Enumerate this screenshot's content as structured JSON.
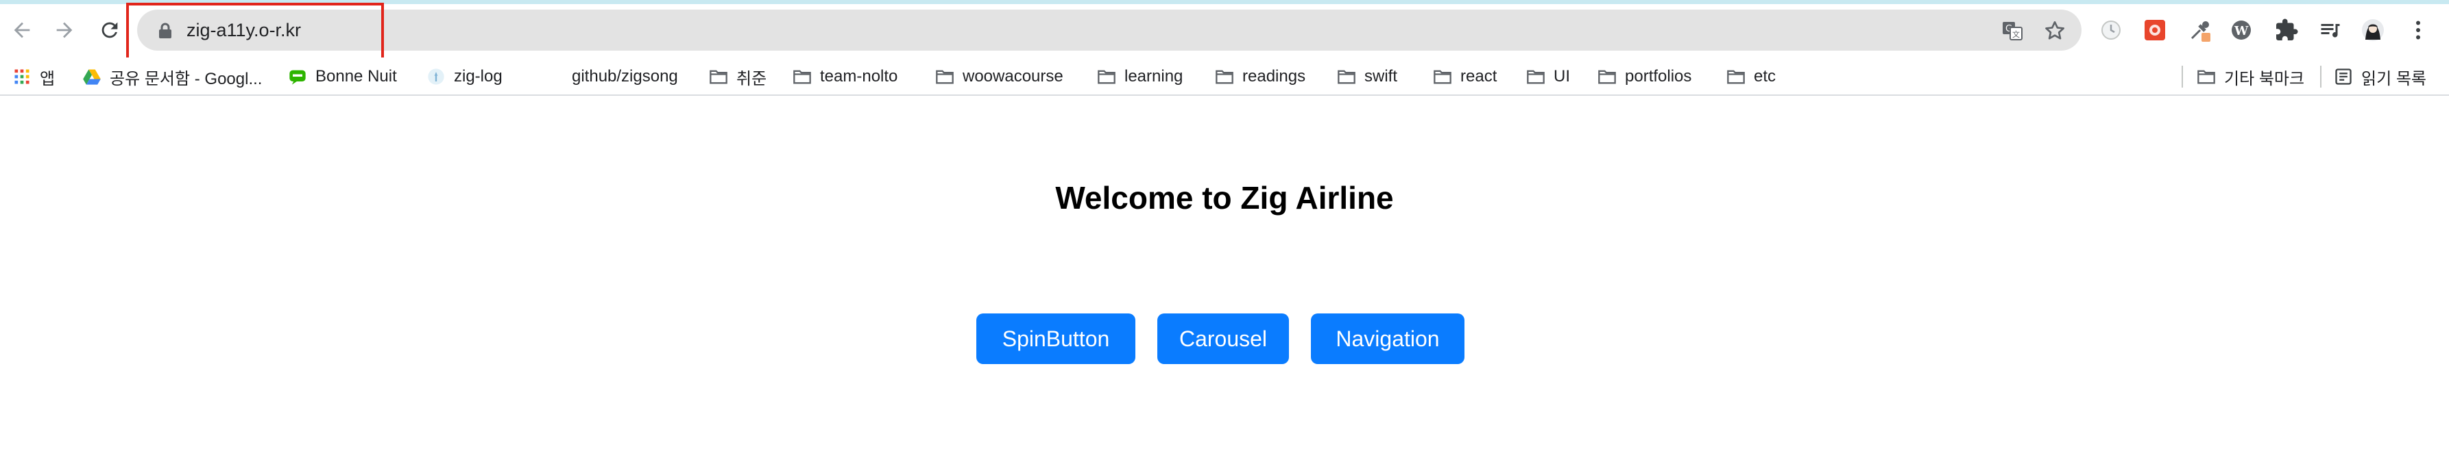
{
  "browser": {
    "url": "zig-a11y.o-r.kr",
    "icons": {
      "back": "arrow-left-icon",
      "forward": "arrow-right-icon",
      "reload": "reload-icon",
      "lock": "lock-icon",
      "translate": "translate-icon",
      "bookmark_star": "star-icon",
      "extensions": "puzzle-icon",
      "reading_list": "reading-list-icon",
      "profile": "avatar-icon",
      "menu": "more-vert-icon"
    }
  },
  "bookmarks": {
    "apps_label": "앱",
    "items": [
      {
        "label": "공유 문서함 - Googl...",
        "icon": "google-drive-icon"
      },
      {
        "label": "Bonne Nuit",
        "icon": "chat-icon"
      },
      {
        "label": "zig-log",
        "icon": "favicon-icon"
      },
      {
        "label": "github/zigsong",
        "icon": ""
      },
      {
        "label": "취준",
        "icon": "folder-icon"
      },
      {
        "label": "team-nolto",
        "icon": "folder-icon"
      },
      {
        "label": "woowacourse",
        "icon": "folder-icon"
      },
      {
        "label": "learning",
        "icon": "folder-icon"
      },
      {
        "label": "readings",
        "icon": "folder-icon"
      },
      {
        "label": "swift",
        "icon": "folder-icon"
      },
      {
        "label": "react",
        "icon": "folder-icon"
      },
      {
        "label": "UI",
        "icon": "folder-icon"
      },
      {
        "label": "portfolios",
        "icon": "folder-icon"
      },
      {
        "label": "etc",
        "icon": "folder-icon"
      }
    ],
    "other_bookmarks": "기타 북마크",
    "reading_list": "읽기 목록"
  },
  "page": {
    "title": "Welcome to Zig Airline",
    "buttons": [
      "SpinButton",
      "Carousel",
      "Navigation"
    ],
    "accent_color": "#0a7cff"
  }
}
